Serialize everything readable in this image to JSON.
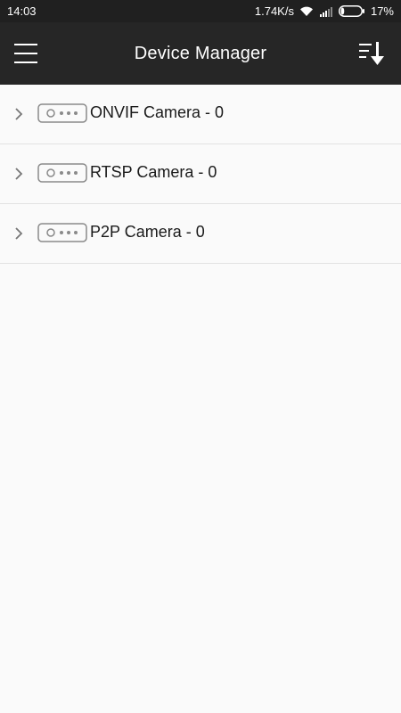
{
  "status_bar": {
    "time": "14:03",
    "network_speed": "1.74K/s",
    "battery_percent": "17%",
    "battery_level": 0.17,
    "icons": [
      "wifi-icon",
      "signal-icon",
      "battery-icon"
    ]
  },
  "app_bar": {
    "title": "Device Manager",
    "left_icon": "menu-icon",
    "right_icon": "sort-icon"
  },
  "device_groups": [
    {
      "label": "ONVIF Camera - 0",
      "icon": "camera-device-icon"
    },
    {
      "label": "RTSP Camera - 0",
      "icon": "camera-device-icon"
    },
    {
      "label": "P2P Camera - 0",
      "icon": "camera-device-icon"
    }
  ],
  "colors": {
    "status_bar_bg": "#202020",
    "app_bar_bg": "#262626",
    "page_bg": "#fafafa",
    "divider": "#e2e2e2"
  }
}
